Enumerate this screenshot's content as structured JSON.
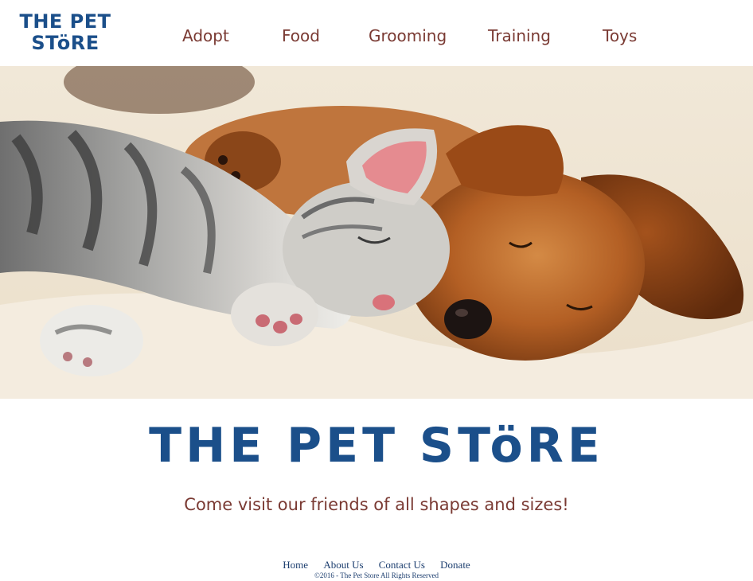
{
  "header": {
    "logo_line1": "THE PET",
    "logo_line2": "STöRE",
    "nav": [
      {
        "label": "Adopt"
      },
      {
        "label": "Food"
      },
      {
        "label": "Grooming"
      },
      {
        "label": "Training"
      },
      {
        "label": "Toys"
      }
    ]
  },
  "hero": {
    "image_subject": "kitten-and-puppy-sleeping-photo"
  },
  "main": {
    "title": "THE PET STöRE",
    "tagline": "Come visit our friends of all shapes and sizes!"
  },
  "footer": {
    "links": [
      {
        "label": "Home"
      },
      {
        "label": "About Us"
      },
      {
        "label": "Contact Us"
      },
      {
        "label": "Donate"
      }
    ],
    "copyright": "©2016 - The Pet Store All Rights Reserved"
  },
  "colors": {
    "brand_blue": "#1b4f8a",
    "nav_brown": "#7a3a33",
    "footer_blue": "#1b3d6e"
  }
}
